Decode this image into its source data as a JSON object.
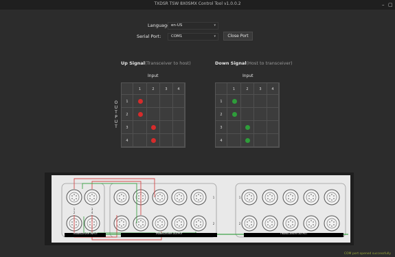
{
  "app": {
    "title": "TXDSR TSW 8X0SMX Control Tool v1.0.0.2",
    "minimize_glyph": "–",
    "maximize_glyph": "▢"
  },
  "controls": {
    "language_label": "Language:",
    "language_value": "en-US",
    "serial_label": "Serial Port:",
    "serial_value": "COM1",
    "close_port_label": "Close Port",
    "dropdown_glyph": "▾"
  },
  "up": {
    "title": "Up Signal",
    "subtitle": "(Transceiver to host)",
    "input_label": "Input",
    "inputs": [
      "1",
      "2",
      "3",
      "4"
    ],
    "outputs": [
      "1",
      "2",
      "3",
      "4"
    ],
    "active": [
      [
        0,
        0
      ],
      [
        1,
        0
      ],
      [
        2,
        1
      ],
      [
        3,
        1
      ]
    ],
    "dot_color": "#d62b2b"
  },
  "down": {
    "title": "Down Signal",
    "subtitle": "(Host to transceiver)",
    "input_label": "Input",
    "inputs": [
      "1",
      "2",
      "3",
      "4"
    ],
    "outputs": [
      "1",
      "2",
      "3",
      "4"
    ],
    "active": [
      [
        0,
        0
      ],
      [
        1,
        0
      ],
      [
        2,
        1
      ],
      [
        3,
        1
      ]
    ],
    "dot_color": "#2e9d3a"
  },
  "output_letters": [
    "O",
    "U",
    "T",
    "P",
    "U",
    "T"
  ],
  "panel": {
    "left_label": "TRANSCEIVER INPUT",
    "mid_label": "TRANSCEIVER OUTPUT",
    "right_label": "TRANSCEIVER OUTPUT",
    "port_nums": [
      "1",
      "3",
      "2",
      "4"
    ],
    "row_nums": [
      "1",
      "2"
    ]
  },
  "status_text": "COM port opened successfully"
}
